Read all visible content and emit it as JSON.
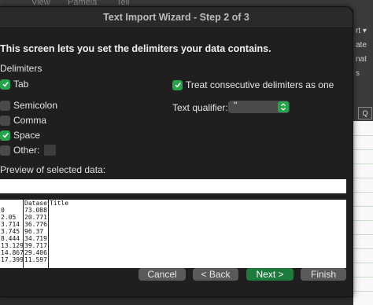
{
  "background_app": {
    "menu_fragments": [
      "View",
      "Pamela",
      "Tell"
    ],
    "right_panel_texts": [
      "rt ▾",
      "ate",
      "nat",
      "s"
    ],
    "right_panel_box": "Q"
  },
  "dialog": {
    "title": "Text Import Wizard - Step 2 of 3",
    "intro": "This screen lets you set the delimiters your data contains.",
    "delimiters_label": "Delimiters",
    "delimiters": [
      {
        "label": "Tab",
        "checked": true
      },
      {
        "label": "Semicolon",
        "checked": false
      },
      {
        "label": "Comma",
        "checked": false
      },
      {
        "label": "Space",
        "checked": true
      },
      {
        "label": "Other:",
        "checked": false
      }
    ],
    "treat_consecutive": {
      "label": "Treat consecutive delimiters as one",
      "checked": true
    },
    "text_qualifier": {
      "label": "Text qualifier:",
      "value": "\""
    },
    "preview_label": "Preview of selected data:",
    "preview": {
      "columns": [
        [
          "",
          "0",
          "2.05",
          "3.714",
          "3.745",
          "8.444",
          "13.129",
          "14.867",
          "17.399"
        ],
        [
          "Dataset",
          "73.088",
          "20.771",
          "36.776",
          "96.37",
          "34.719",
          "39.717",
          "29.406",
          "11.597"
        ],
        [
          "Title",
          "",
          "",
          "",
          "",
          "",
          "",
          "",
          ""
        ]
      ]
    },
    "buttons": {
      "cancel": "Cancel",
      "back": "< Back",
      "next": "Next >",
      "finish": "Finish"
    }
  },
  "colors": {
    "accent_green": "#27a34a",
    "primary_button": "#1d7b3e",
    "dialog_bg": "#1f1f1f"
  }
}
